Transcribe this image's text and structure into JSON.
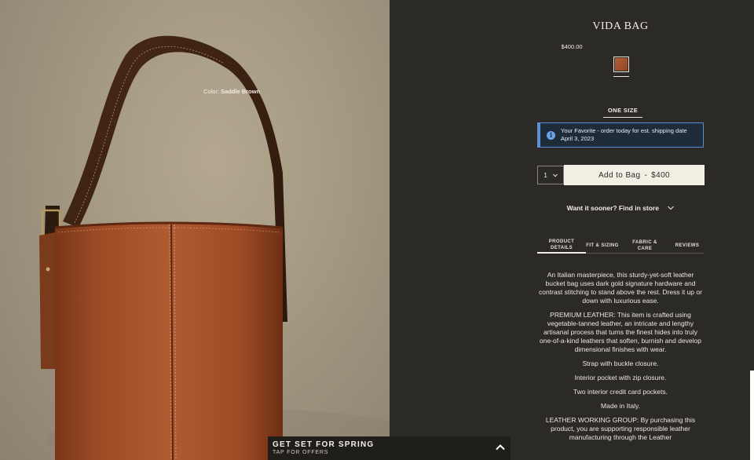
{
  "product": {
    "title": "VIDA BAG",
    "price": "$400.00",
    "color_label": "Color:",
    "color_value": "Saddle Brown",
    "size_option": "ONE SIZE",
    "swatch_color": "#a9532e"
  },
  "alert": {
    "text": "Your Favorite - order today for est. shipping date April 3, 2023",
    "icon": "info-icon",
    "accent": "#5b8fd6"
  },
  "purchase": {
    "quantity": "1",
    "add_to_bag_label": "Add to Bag",
    "add_to_bag_separator": "-",
    "add_to_bag_price": "$400"
  },
  "store": {
    "find_label": "Want it sooner? Find in store"
  },
  "tabs": [
    {
      "label": "PRODUCT DETAILS",
      "active": true
    },
    {
      "label": "FIT & SIZING",
      "active": false
    },
    {
      "label": "FABRIC & CARE",
      "active": false
    },
    {
      "label": "REVIEWS",
      "active": false
    }
  ],
  "description": [
    "An Italian masterpiece, this sturdy-yet-soft leather bucket bag uses dark gold signature hardware and contrast stitching to stand above the rest. Dress it up or down with luxurious ease.",
    "PREMIUM LEATHER: This item is crafted using vegetable-tanned leather, an intricate and lengthy artisanal process that turns the finest hides into truly one-of-a-kind leathers that soften, burnish and develop dimensional finishes with wear.",
    "Strap with buckle closure.",
    "Interior pocket with zip closure.",
    "Two interior credit card pockets.",
    "Made in Italy.",
    "LEATHER WORKING GROUP: By purchasing this product, you are supporting responsible leather manufacturing through the Leather"
  ],
  "promo": {
    "title": "GET SET FOR SPRING",
    "subtitle": "TAP FOR OFFERS"
  },
  "colors": {
    "panel_bg": "#2c2a26",
    "button_bg": "#f4efe5",
    "leather": "#a9532e",
    "backdrop": "#a39881"
  }
}
